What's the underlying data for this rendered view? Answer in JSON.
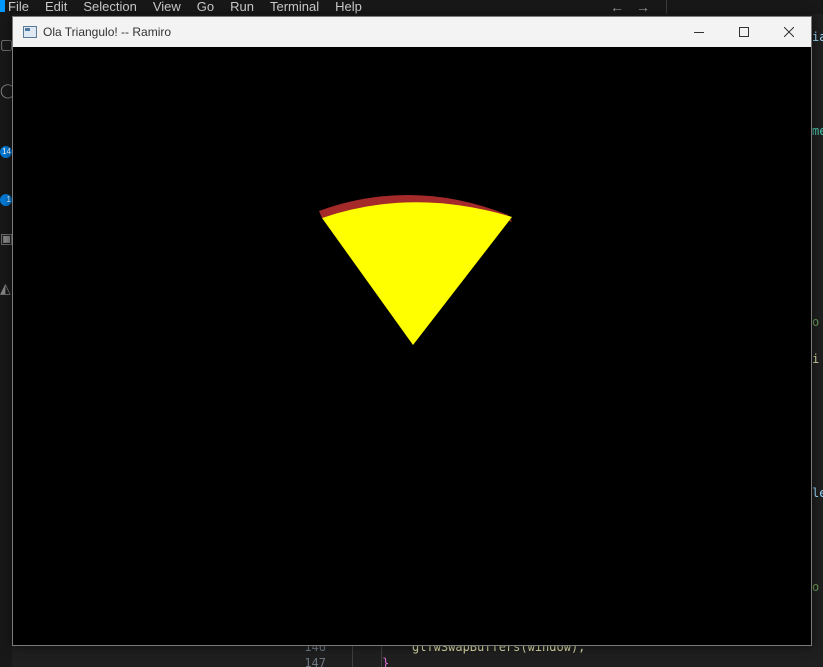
{
  "menu": {
    "items": [
      "File",
      "Edit",
      "Selection",
      "View",
      "Go",
      "Run",
      "Terminal",
      "Help"
    ]
  },
  "nav": {
    "back_icon": "arrow-left-icon",
    "forward_icon": "arrow-right-icon"
  },
  "activity": {
    "badges": [
      "14",
      "1"
    ]
  },
  "background_code": {
    "line_numbers": [
      "146",
      "147"
    ],
    "line_146": "glfwSwapBuffers(window);",
    "line_147": "}"
  },
  "right_fragments": [
    "ia",
    "me",
    "o",
    "i",
    "le",
    "o"
  ],
  "window": {
    "title": "Ola Triangulo! -- Ramiro",
    "buttons": [
      "minimize",
      "maximize",
      "close"
    ]
  },
  "scene": {
    "background": "#000000",
    "slice_color": "#ffff00",
    "crust_color": "#a52a2a"
  },
  "colors": {
    "accent": "#0078d4",
    "editor_bg": "#1e1e1e"
  }
}
